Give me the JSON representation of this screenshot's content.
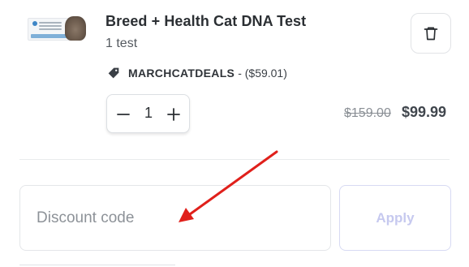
{
  "product": {
    "title": "Breed + Health Cat DNA Test",
    "variant": "1 test",
    "image": "cat-dna-test-kit-box"
  },
  "discount_applied": {
    "code": "MARCHCATDEALS",
    "amount": "- ($59.01)",
    "icon": "tag-icon"
  },
  "quantity": {
    "value": "1",
    "decrement_icon": "minus-icon",
    "increment_icon": "plus-icon"
  },
  "price": {
    "original": "$159.00",
    "current": "$99.99"
  },
  "actions": {
    "delete_icon": "trash-icon"
  },
  "discount_form": {
    "placeholder": "Discount code",
    "apply_label": "Apply"
  },
  "colors": {
    "annotation_arrow": "#e0201b",
    "apply_disabled_text": "#c6c9ef"
  }
}
